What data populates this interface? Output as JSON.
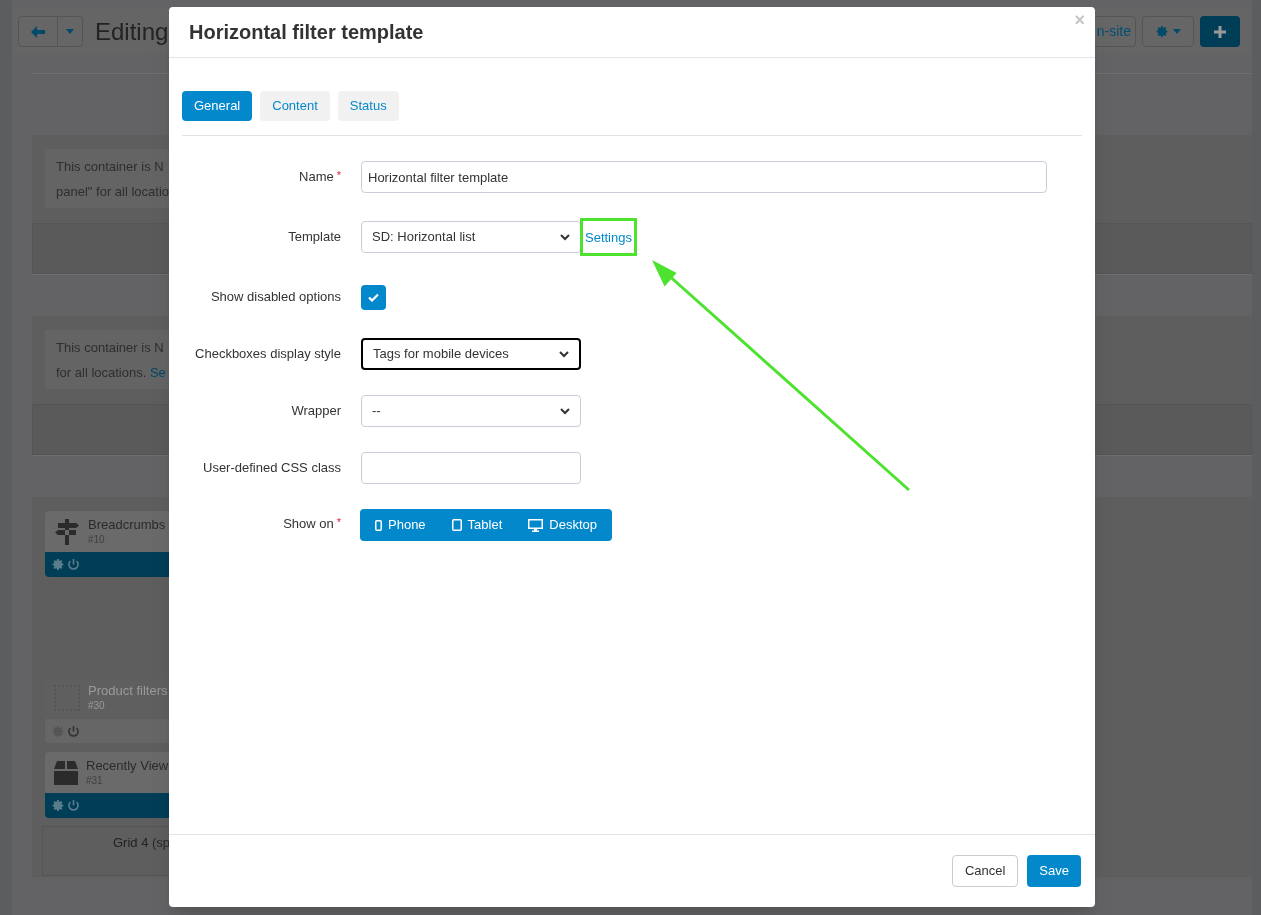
{
  "background_page": {
    "title": "Editing",
    "header_buttons": [
      {
        "kind": "text",
        "label": "n-site"
      },
      {
        "kind": "gear"
      },
      {
        "kind": "plus"
      }
    ],
    "notices": [
      {
        "lines": [
          "This container is N",
          "panel\" for all locatio"
        ]
      },
      {
        "lines": [
          "This container is N",
          "for all locations. "
        ],
        "link": "Se"
      }
    ],
    "blocks": [
      {
        "kind": "signpost",
        "name": "Breadcrumbs",
        "id": "#10",
        "disabled": false
      },
      {
        "kind": "placeholder",
        "name": "Product filters",
        "id": "#30",
        "disabled": true
      },
      {
        "kind": "box",
        "name": "Recently View",
        "id": "#31",
        "disabled": false
      }
    ],
    "grid_label": "Grid 4",
    "grid_note": "(sp"
  },
  "modal": {
    "title": "Horizontal filter template",
    "close": "×",
    "tabs": [
      {
        "label": "General",
        "selected": true
      },
      {
        "label": "Content",
        "selected": false
      },
      {
        "label": "Status",
        "selected": false
      }
    ],
    "fields": [
      {
        "kind": "text",
        "label": "Name",
        "required_mark": "*",
        "value": "Horizontal filter template",
        "wide": true
      },
      {
        "kind": "select",
        "label": "Template",
        "value": "SD: Horizontal list",
        "link": {
          "label": "Settings",
          "highlighted": true
        }
      },
      {
        "kind": "checkbox",
        "label": "Show disabled options",
        "checked": true
      },
      {
        "kind": "select",
        "label": "Checkboxes display style",
        "value": "Tags for mobile devices",
        "focused": true
      },
      {
        "kind": "select",
        "label": "Wrapper",
        "value": "--",
        "focused": false
      },
      {
        "kind": "text",
        "label": "User-defined CSS class",
        "wide": false
      },
      {
        "kind": "devices",
        "label": "Show on",
        "required_mark": "*",
        "options": [
          {
            "kind": "phone",
            "label": "Phone"
          },
          {
            "kind": "tablet",
            "label": "Tablet"
          },
          {
            "kind": "desktop",
            "label": "Desktop"
          }
        ]
      }
    ],
    "buttons": [
      {
        "kind": "secondary",
        "label": "Cancel"
      },
      {
        "kind": "primary",
        "label": "Save"
      }
    ]
  }
}
